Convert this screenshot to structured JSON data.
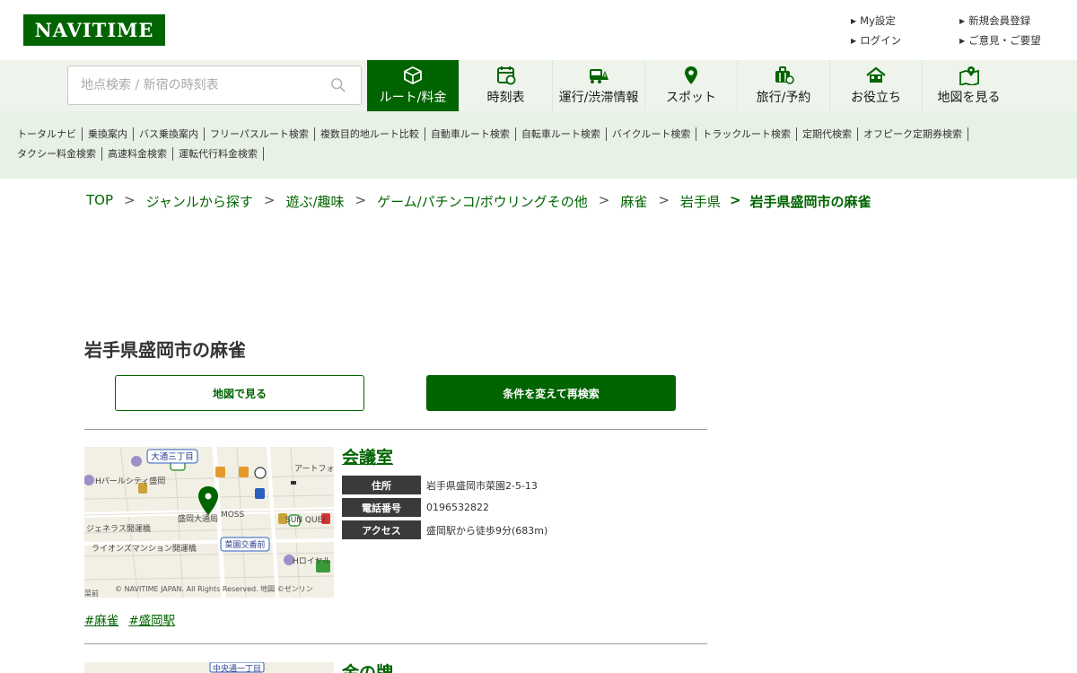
{
  "header": {
    "logo": "NAVITIME",
    "links_left": [
      {
        "label": "My設定"
      },
      {
        "label": "ログイン"
      }
    ],
    "links_right": [
      {
        "label": "新規会員登録"
      },
      {
        "label": "ご意見・ご要望"
      }
    ]
  },
  "search": {
    "placeholder": "地点検索 / 新宿の時刻表"
  },
  "nav": {
    "tabs": [
      {
        "label": "ルート/料金",
        "icon": "route-fare-icon"
      },
      {
        "label": "時刻表",
        "icon": "timetable-icon"
      },
      {
        "label": "運行/渋滞情報",
        "icon": "traffic-info-icon"
      },
      {
        "label": "スポット",
        "icon": "spot-pin-icon"
      },
      {
        "label": "旅行/予約",
        "icon": "travel-suitcase-icon"
      },
      {
        "label": "お役立ち",
        "icon": "useful-house-icon"
      },
      {
        "label": "地図を見る",
        "icon": "map-icon"
      }
    ]
  },
  "subnav": {
    "row1": [
      "トータルナビ",
      "乗換案内",
      "バス乗換案内",
      "フリーパスルート検索",
      "複数目的地ルート比較",
      "自動車ルート検索",
      "自転車ルート検索",
      "バイクルート検索",
      "トラックルート検索",
      "定期代検索",
      "オフピーク定期券検索"
    ],
    "row2": [
      "タクシー料金検索",
      "高速料金検索",
      "運転代行料金検索"
    ]
  },
  "breadcrumb": {
    "items": [
      "TOP",
      "ジャンルから探す",
      "遊ぶ/趣味",
      "ゲーム/パチンコ/ボウリングその他",
      "麻雀",
      "岩手県"
    ],
    "separator": ">",
    "current": "岩手県盛岡市の麻雀"
  },
  "page": {
    "title": "岩手県盛岡市の麻雀",
    "map_button": "地図で見る",
    "research_button": "条件を変えて再検索"
  },
  "results": [
    {
      "name": "会議室",
      "rows": [
        {
          "label": "住所",
          "value": "岩手県盛岡市菜園2-5-13"
        },
        {
          "label": "電話番号",
          "value": "0196532822"
        },
        {
          "label": "アクセス",
          "value": "盛岡駅から徒歩9分(683m)"
        }
      ],
      "tags": [
        "#麻雀",
        "#盛岡駅"
      ],
      "map": {
        "labels": [
          "大通三丁目",
          "Hパールシティ盛岡",
          "アートフォ",
          "盛岡大通局",
          "MOSS",
          "SUN QUEE",
          "ジェネラス開運橋",
          "ライオンズマンション開運橋",
          "菜園交番前",
          "Hロイヤル",
          "菜前"
        ],
        "copyright": "© NAVITIME JAPAN. All Rights Reserved. 地図 ©ゼンリン"
      }
    },
    {
      "name": "金の牌",
      "map": {
        "labels": [
          "中央通一丁目"
        ]
      }
    }
  ],
  "colors": {
    "brand": "#006400",
    "nav_bg": "#eef4ec",
    "subnav_bg": "#e8f1e5",
    "label_bg": "#3a3a3a"
  }
}
